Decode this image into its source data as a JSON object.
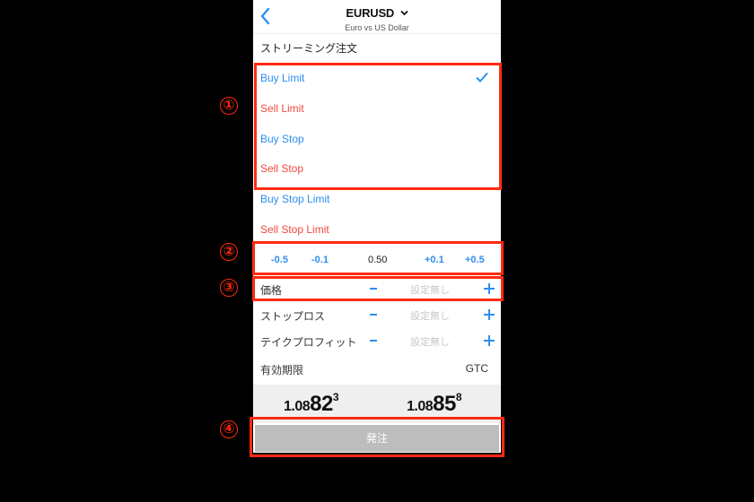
{
  "header": {
    "back_icon": "chevron-left-icon",
    "title": "EURUSD",
    "title_dropdown_icon": "chevron-down-icon",
    "subtitle": "Euro vs US Dollar"
  },
  "section_title": "ストリーミング注文",
  "order_types": [
    {
      "label": "Buy Limit",
      "side": "buy",
      "selected": true
    },
    {
      "label": "Sell Limit",
      "side": "sell",
      "selected": false
    },
    {
      "label": "Buy Stop",
      "side": "buy",
      "selected": false
    },
    {
      "label": "Sell Stop",
      "side": "sell",
      "selected": false
    },
    {
      "label": "Buy Stop Limit",
      "side": "buy",
      "selected": false
    },
    {
      "label": "Sell Stop Limit",
      "side": "sell",
      "selected": false
    }
  ],
  "volume_stepper": {
    "minus_large": "-0.5",
    "minus_small": "-0.1",
    "value": "0.50",
    "plus_small": "+0.1",
    "plus_large": "+0.5"
  },
  "fields": [
    {
      "label": "価格",
      "value": "設定無し"
    },
    {
      "label": "ストップロス",
      "value": "設定無し"
    },
    {
      "label": "テイクプロフィット",
      "value": "設定無し"
    }
  ],
  "expiry": {
    "label": "有効期限",
    "value": "GTC"
  },
  "quotes": {
    "sell": {
      "prefix": "1.08",
      "big": "82",
      "sup": "3"
    },
    "buy": {
      "prefix": "1.08",
      "big": "85",
      "sup": "8"
    }
  },
  "submit_label": "発注",
  "annotations": {
    "color": "#ff2a12",
    "markers": [
      "①",
      "②",
      "③",
      "④"
    ]
  },
  "colors": {
    "buy": "#2d8ef0",
    "sell": "#f04a3e",
    "submit_bg": "#bdbdbd"
  }
}
